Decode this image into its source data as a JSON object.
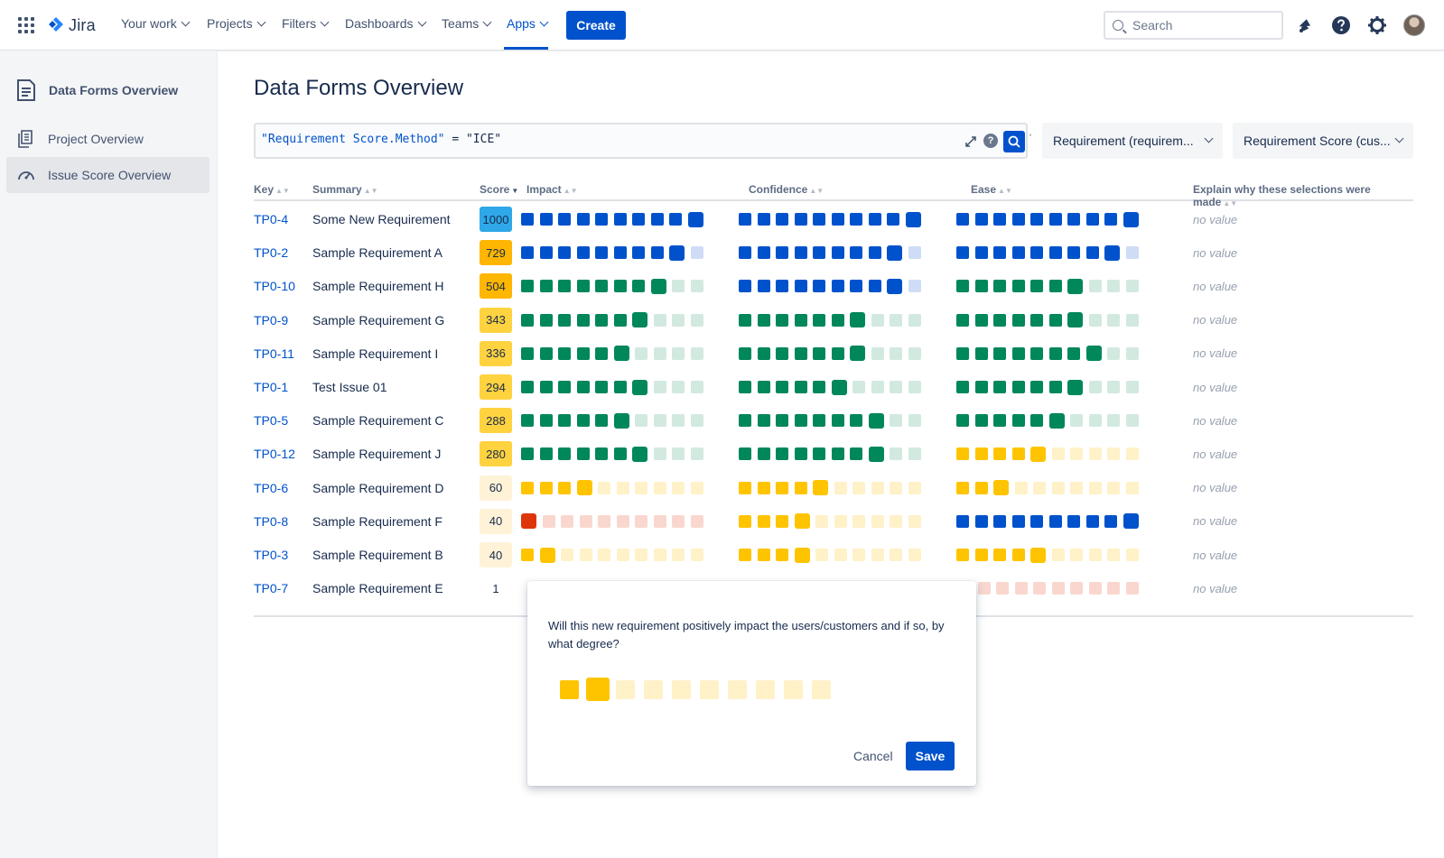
{
  "nav": {
    "logo": "Jira",
    "items": [
      "Your work",
      "Projects",
      "Filters",
      "Dashboards",
      "Teams",
      "Apps"
    ],
    "active": "Apps",
    "create_label": "Create",
    "search_placeholder": "Search",
    "icons": [
      "notification-icon",
      "help-icon",
      "settings-icon",
      "avatar"
    ]
  },
  "sidebar": {
    "header": "Data Forms Overview",
    "items": [
      {
        "label": "Project Overview",
        "icon": "pages-icon"
      },
      {
        "label": "Issue Score Overview",
        "icon": "dashboard-icon",
        "selected": true
      }
    ]
  },
  "main": {
    "title": "Data Forms Overview",
    "query_field": "\"Requirement Score.Method\"",
    "query_op": " = ",
    "query_value": "\"ICE\"",
    "tick_mark": "'",
    "dropdown1": "Requirement (requirem...",
    "dropdown2": "Requirement Score (cus..."
  },
  "table": {
    "headers": [
      "Key",
      "Summary",
      "Score",
      "Impact",
      "Confidence",
      "Ease",
      "Explain why these selections were made"
    ],
    "sorted_column": "Score",
    "no_value": "no value",
    "rows": [
      {
        "key": "TP0-4",
        "summary": "Some New Requirement",
        "score": "1000",
        "impact": 10,
        "confidence": 10,
        "ease": 10
      },
      {
        "key": "TP0-2",
        "summary": "Sample Requirement A",
        "score": "729",
        "impact": 9,
        "confidence": 9,
        "ease": 9
      },
      {
        "key": "TP0-10",
        "summary": "Sample Requirement H",
        "score": "504",
        "impact": 8,
        "confidence": 9,
        "ease": 7
      },
      {
        "key": "TP0-9",
        "summary": "Sample Requirement G",
        "score": "343",
        "impact": 7,
        "confidence": 7,
        "ease": 7
      },
      {
        "key": "TP0-11",
        "summary": "Sample Requirement I",
        "score": "336",
        "impact": 6,
        "confidence": 7,
        "ease": 8
      },
      {
        "key": "TP0-1",
        "summary": "Test Issue 01",
        "score": "294",
        "impact": 7,
        "confidence": 6,
        "ease": 7
      },
      {
        "key": "TP0-5",
        "summary": "Sample Requirement C",
        "score": "288",
        "impact": 6,
        "confidence": 8,
        "ease": 6
      },
      {
        "key": "TP0-12",
        "summary": "Sample Requirement J",
        "score": "280",
        "impact": 7,
        "confidence": 8,
        "ease": 5
      },
      {
        "key": "TP0-6",
        "summary": "Sample Requirement D",
        "score": "60",
        "impact": 4,
        "confidence": 5,
        "ease": 3
      },
      {
        "key": "TP0-8",
        "summary": "Sample Requirement F",
        "score": "40",
        "impact": 1,
        "confidence": 4,
        "ease": 10
      },
      {
        "key": "TP0-3",
        "summary": "Sample Requirement B",
        "score": "40",
        "impact": 2,
        "confidence": 4,
        "ease": 5
      },
      {
        "key": "TP0-7",
        "summary": "Sample Requirement E",
        "score": "1",
        "impact": null,
        "confidence": null,
        "ease": 1
      }
    ]
  },
  "popup": {
    "question": "Will this new requirement positively impact the users/customers and if so, by what degree?",
    "selected": 2,
    "total": 10,
    "cancel_label": "Cancel",
    "save_label": "Save"
  },
  "colors": {
    "blue": "#0052cc",
    "blue_light": "#cfdcf6",
    "green": "#00875a",
    "green_light": "#d2e9df",
    "yellow": "#ffc400",
    "yellow_light": "#fff1c8",
    "red": "#de350b",
    "red_light": "#f9d7cf",
    "score_1000": "#2ea8e8",
    "score_high": "#ffb600",
    "score_mid": "#ffd23f",
    "score_low": "#fff2d6"
  }
}
